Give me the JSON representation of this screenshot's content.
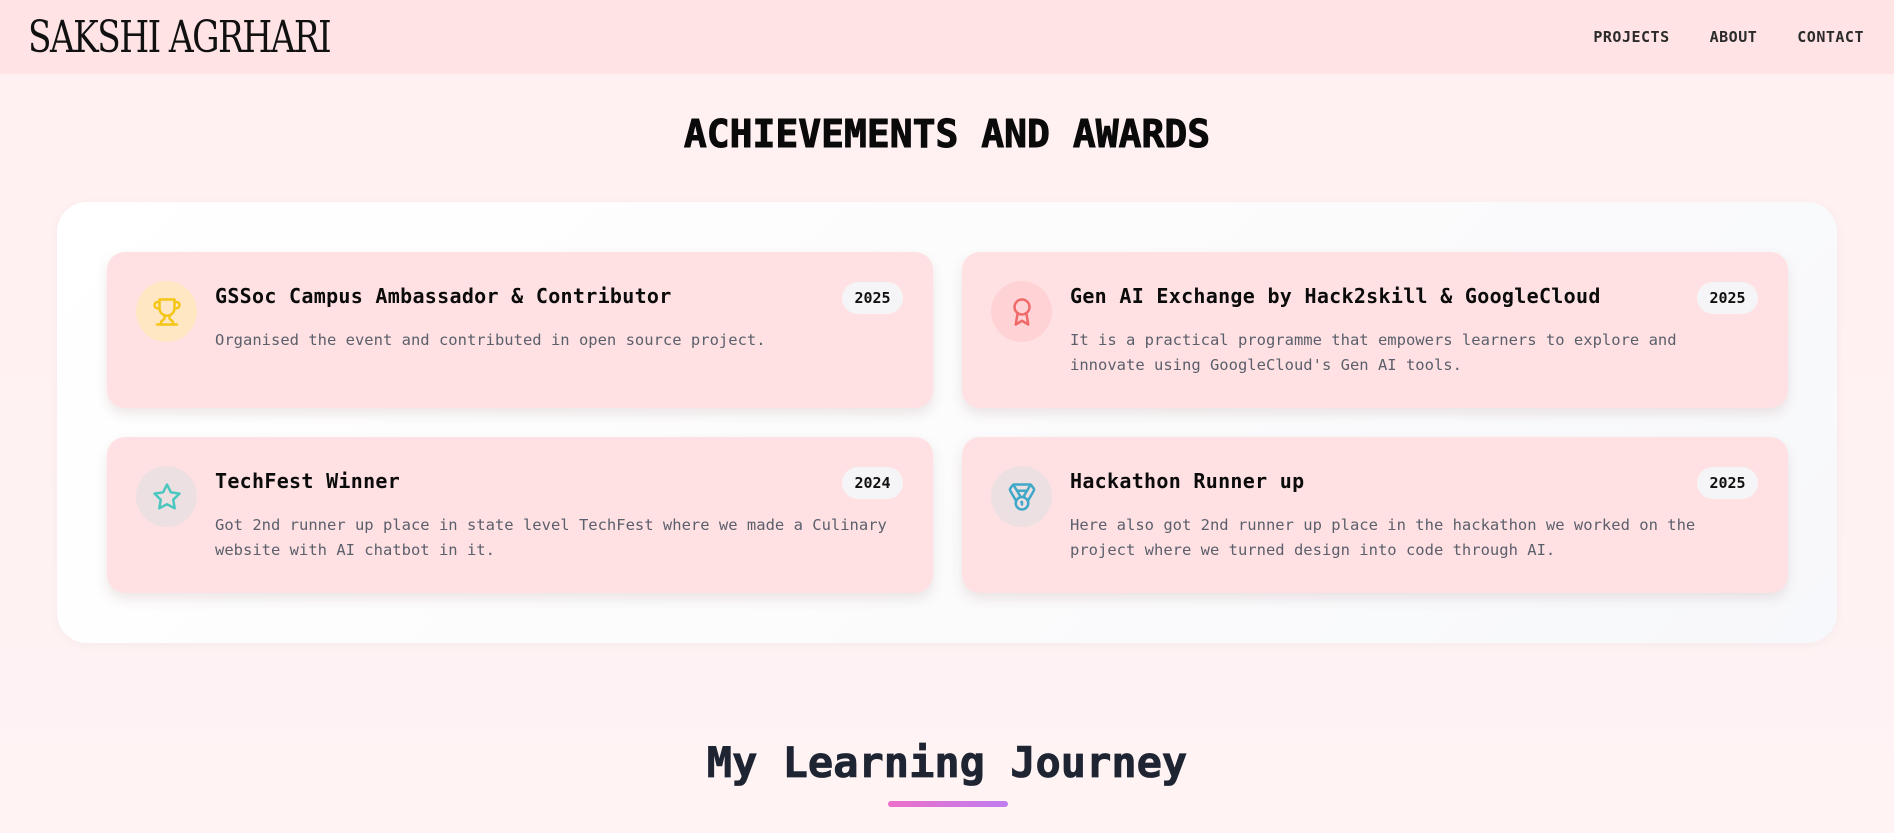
{
  "header": {
    "brand": "SAKSHI AGRHARI",
    "nav": [
      {
        "label": "PROJECTS"
      },
      {
        "label": "ABOUT"
      },
      {
        "label": "CONTACT"
      }
    ]
  },
  "achievements": {
    "title": "ACHIEVEMENTS AND AWARDS",
    "items": [
      {
        "title": "GSSoc Campus Ambassador & Contributor",
        "year": "2025",
        "description": "Organised the event and contributed in open source project.",
        "icon": "trophy-icon",
        "icon_color": "#f5c518",
        "icon_bg": "#ffe7c4"
      },
      {
        "title": "Gen AI Exchange by Hack2skill & GoogleCloud",
        "year": "2025",
        "description": "It is a practical programme that empowers learners to explore and innovate using GoogleCloud's Gen AI tools.",
        "icon": "ribbon-award-icon",
        "icon_color": "#f06a6a",
        "icon_bg": "#ffd3d5"
      },
      {
        "title": "TechFest Winner",
        "year": "2024",
        "description": "Got 2nd runner up place in state level TechFest where we made a Culinary website with AI chatbot in it.",
        "icon": "star-icon",
        "icon_color": "#4cc7c0",
        "icon_bg": "#ede0e2"
      },
      {
        "title": "Hackathon Runner up",
        "year": "2025",
        "description": "Here also got 2nd runner up place in the hackathon we worked on the project where we turned design into code through AI.",
        "icon": "medal-icon",
        "icon_color": "#3fa8c8",
        "icon_bg": "#ede0e2"
      }
    ]
  },
  "journey": {
    "title": "My Learning Journey"
  }
}
